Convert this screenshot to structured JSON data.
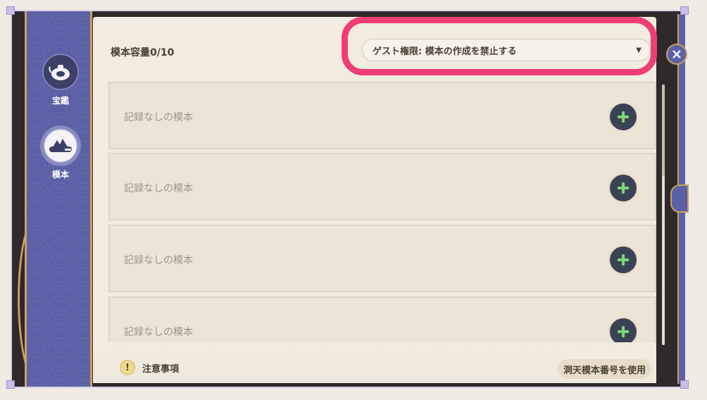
{
  "sidebar": {
    "items": [
      {
        "label": "宝鑑",
        "icon": "teapot-icon",
        "active": false
      },
      {
        "label": "模本",
        "icon": "blueprint-icon",
        "active": true
      }
    ]
  },
  "header": {
    "capacity": "模本容量0/10",
    "permission_dropdown": {
      "value": "ゲスト権限: 模本の作成を禁止する",
      "icon": "chevron-down-icon"
    }
  },
  "slots": [
    {
      "label": "記録なしの模本"
    },
    {
      "label": "記録なしの模本"
    },
    {
      "label": "記録なしの模本"
    },
    {
      "label": "記録なしの模本"
    }
  ],
  "footer": {
    "notice_icon": "!",
    "notice_label": "注意事項",
    "use_code_label": "洞天模本番号を使用"
  },
  "colors": {
    "sidebar": "#5c60a6",
    "panel": "#f1ebe0",
    "highlight": "#ef3e76",
    "add_plus": "#7fd67a",
    "gold": "#c8a060"
  }
}
